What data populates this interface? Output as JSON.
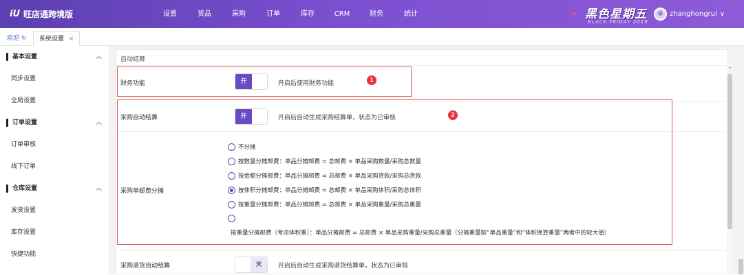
{
  "header": {
    "logo_mark": "iU",
    "app_title": "旺店通跨境版",
    "nav": [
      "设置",
      "货品",
      "采购",
      "订单",
      "库存",
      "CRM",
      "财务",
      "统计"
    ],
    "promo_cn": "黑色星期五",
    "promo_en": "BLACK FRIDAY 2019",
    "username": "zhanghongrui",
    "user_chevron": "∨"
  },
  "tabs": {
    "home": "欢迎",
    "home_icon": "↻",
    "active": "系统设置",
    "close": "×"
  },
  "sidebar": {
    "sections": [
      {
        "title": "基本设置",
        "items": [
          "同步设置",
          "全局设置"
        ]
      },
      {
        "title": "订单设置",
        "items": [
          "订单审核",
          "线下订单"
        ]
      },
      {
        "title": "仓库设置",
        "items": [
          "发货设置",
          "库存设置",
          "快捷功能"
        ]
      }
    ],
    "collapse_icon": "︽"
  },
  "main": {
    "section_title": "自动结算",
    "rows": {
      "finance": {
        "label": "财务功能",
        "toggle": "开",
        "desc": "开启后使用财务功能",
        "marker": "1"
      },
      "purchase_settle": {
        "label": "采购自动结算",
        "toggle": "开",
        "desc": "开启后自动生成采购结算单，状态为已审核",
        "marker": "2"
      },
      "shipping_split": {
        "label": "采购单邮费分摊",
        "options": [
          "不分摊",
          "按数量分摊邮费：单品分摊邮费 = 总邮费 × 单品采购数量/采购总数量",
          "按金额分摊邮费：单品分摊邮费 = 总邮费 × 单品采购货款/采购总货款",
          "按体积分摊邮费：单品分摊邮费 = 总邮费 × 单品采购体积/采购总体积",
          "按重量分摊邮费：单品分摊邮费 = 总邮费 × 单品采购重量/采购总重量",
          "按重量分摊邮费（考虑体积重）：单品分摊邮费 = 总邮费 × 单品采购重量/采购总重量（分摊重量取“单品重量”和“体积换算重量”两者中的较大值）"
        ],
        "selected_index": 3
      },
      "return_settle": {
        "label": "采购退货自动结算",
        "toggle": "关",
        "desc": "开启后自动生成采购退货结算单，状态为已审核"
      }
    }
  },
  "colors": {
    "accent": "#6a4bc4",
    "marker": "#e8343a",
    "highlight_box": "#e35a5a",
    "topbar": "#6a47c2"
  },
  "icons": {
    "scroll_up": "^"
  }
}
